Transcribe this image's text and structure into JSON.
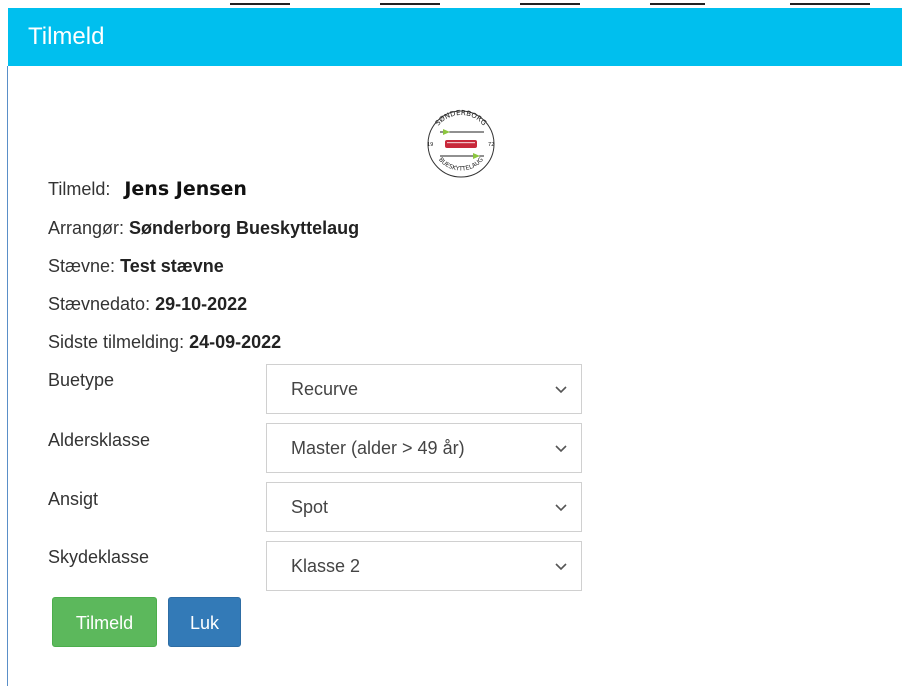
{
  "dialog": {
    "title": "Tilmeld"
  },
  "info": {
    "tilmeld_label": "Tilmeld:",
    "tilmeld_value": "Jens Jensen",
    "arrangor_label": "Arrangør:",
    "arrangor_value": "Sønderborg Bueskyttelaug",
    "staevne_label": "Stævne:",
    "staevne_value": "Test stævne",
    "staevnedato_label": "Stævnedato:",
    "staevnedato_value": "29-10-2022",
    "sidste_label": "Sidste tilmelding:",
    "sidste_value": "24-09-2022"
  },
  "logo": {
    "text_top": "SØNDERBORG",
    "text_bottom": "BUESKYTTELAUG",
    "year_left": "19",
    "year_right": "72",
    "colors": {
      "red": "#c8283a",
      "green": "#8cc63f",
      "dark": "#222222"
    }
  },
  "form": {
    "buetype": {
      "label": "Buetype",
      "value": "Recurve"
    },
    "aldersklasse": {
      "label": "Aldersklasse",
      "value": "Master (alder > 49 år)"
    },
    "ansigt": {
      "label": "Ansigt",
      "value": "Spot"
    },
    "skydeklasse": {
      "label": "Skydeklasse",
      "value": "Klasse 2"
    }
  },
  "buttons": {
    "submit": "Tilmeld",
    "close": "Luk"
  },
  "colors": {
    "header": "#00bfee",
    "btn_green": "#5cb85c",
    "btn_blue": "#337ab7"
  }
}
